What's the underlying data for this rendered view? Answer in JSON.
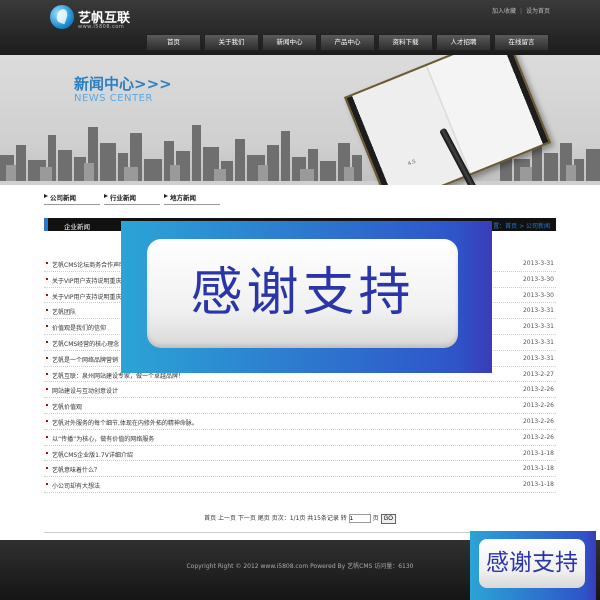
{
  "header": {
    "logo_name": "艺帆互联",
    "logo_url": "www.i5808.com",
    "top_links": [
      "加入收藏",
      "设为首页"
    ],
    "nav": [
      "首页",
      "关于我们",
      "新闻中心",
      "产品中心",
      "资料下载",
      "人才招聘",
      "在线留言"
    ]
  },
  "banner": {
    "title": "新闻中心>>>",
    "subtitle": "NEWS CENTER",
    "book_code": "4.5"
  },
  "tabs": [
    "公司新闻",
    "行业新闻",
    "地方新闻"
  ],
  "section": {
    "title": "企业新闻",
    "breadcrumb": "置：首页 > 公司新闻"
  },
  "news": [
    {
      "title": "艺帆CMS论坛商务合作声明",
      "date": "2013-3-31"
    },
    {
      "title": "关于VIP用户支持说明重庆",
      "date": "2013-3-30"
    },
    {
      "title": "关于VIP用户支持说明重庆",
      "date": "2013-3-30"
    },
    {
      "title": "艺帆团队",
      "date": "2013-3-31"
    },
    {
      "title": "价值观是我们的信仰",
      "date": "2013-3-31"
    },
    {
      "title": "艺帆CMS经营的核心理念",
      "date": "2013-3-31"
    },
    {
      "title": "艺帆是一个网络品牌营销",
      "date": "2013-3-31"
    },
    {
      "title": "艺帆互联：泉州网站建设专家，做一个卓越品牌！",
      "date": "2013-2-27"
    },
    {
      "title": "网站建设与互动创意设计",
      "date": "2013-2-26"
    },
    {
      "title": "艺帆价值观",
      "date": "2013-2-26"
    },
    {
      "title": "艺帆对外服务的每个细节,体现在内修外拓的精神命脉。",
      "date": "2013-2-26"
    },
    {
      "title": "以“传播”为核心，做有价值的网络服务",
      "date": "2013-2-26"
    },
    {
      "title": "艺帆CMS企业版1.7V详细介绍",
      "date": "2013-1-18"
    },
    {
      "title": "艺帆意味着什么？",
      "date": "2013-1-18"
    },
    {
      "title": "小公司却有大想法",
      "date": "2013-1-18"
    }
  ],
  "pagination": {
    "text": "首页  上一页  下一页  尾页  页次：1/1页  共15条记录  转",
    "input_value": "1",
    "page_suffix": "页",
    "go_label": "GO"
  },
  "footer": {
    "text": "Copyright Right © 2012 www.i5808.com Powered By 艺帆CMS 访问量：6130"
  },
  "overlay": {
    "big_text": "感谢支持",
    "small_text": "感谢支持"
  }
}
